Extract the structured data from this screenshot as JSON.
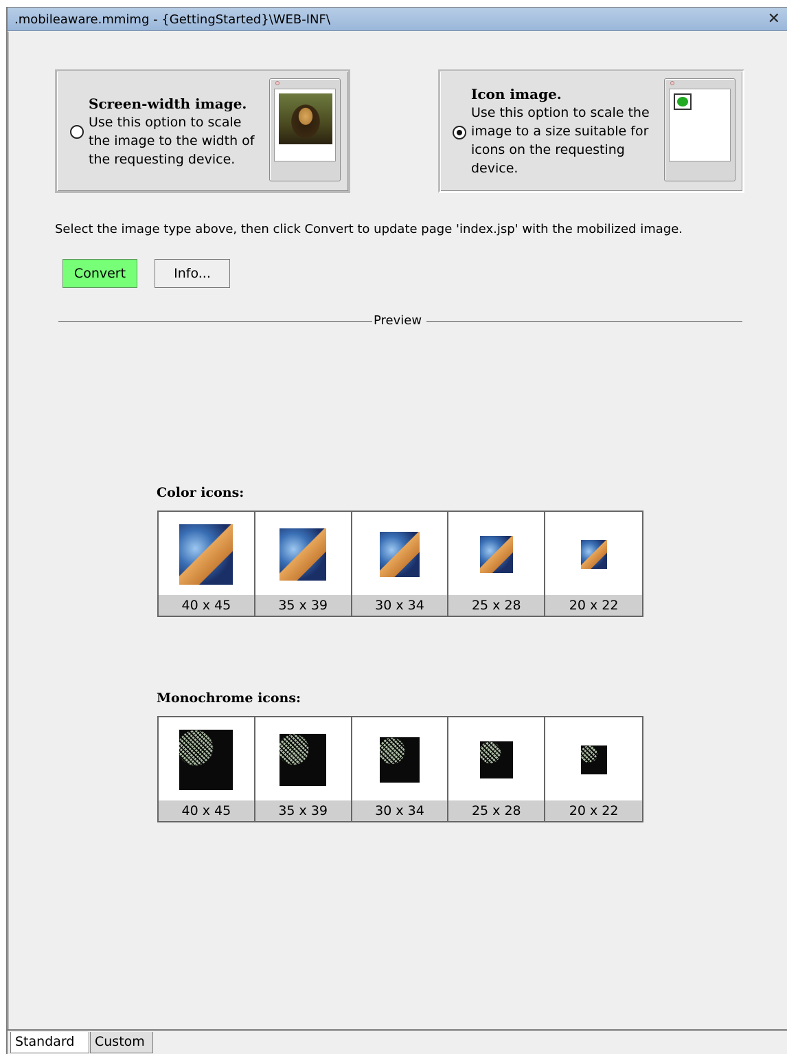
{
  "window": {
    "title": ".mobileaware.mmimg - {GettingStarted}\\WEB-INF\\",
    "close_symbol": "✕"
  },
  "options": {
    "screen_width": {
      "title": "Screen-width image.",
      "description": "Use this option to scale the image to the width of the requesting device.",
      "selected": false
    },
    "icon": {
      "title": "Icon image.",
      "description": "Use this option to scale the image to a size suitable for icons on the requesting device.",
      "selected": true
    }
  },
  "instruction": "Select the image type above, then click Convert to update page 'index.jsp' with the mobilized image.",
  "buttons": {
    "convert": "Convert",
    "info": "Info..."
  },
  "preview": {
    "label": "Preview",
    "color_icons_title": "Color icons:",
    "monochrome_icons_title": "Monochrome icons:",
    "color_sizes": [
      "40 x 45",
      "35 x 39",
      "30 x 34",
      "25 x 28",
      "20 x 22"
    ],
    "monochrome_sizes": [
      "40 x 45",
      "35 x 39",
      "30 x 34",
      "25 x 28",
      "20 x 22"
    ]
  },
  "tabs": {
    "standard": "Standard",
    "custom": "Custom"
  },
  "colors": {
    "convert_button": "#77ff77",
    "titlebar": "#9ab7da"
  }
}
